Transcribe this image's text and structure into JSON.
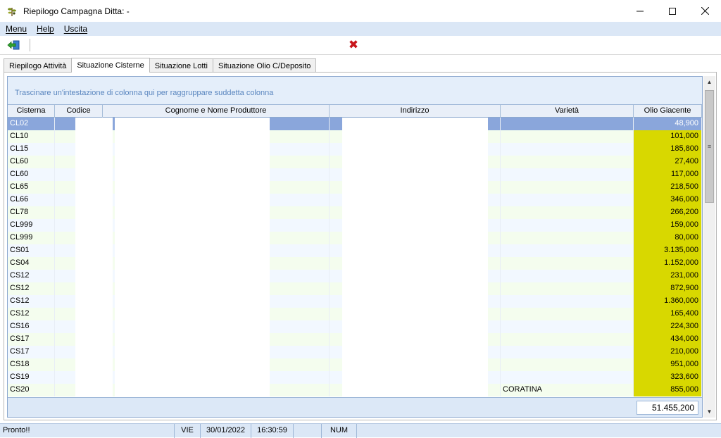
{
  "window": {
    "title": "Riepilogo Campagna Ditta: -",
    "icon": "olive-branch-icon",
    "controls": [
      "minimize",
      "maximize",
      "close"
    ]
  },
  "menu": {
    "items": [
      {
        "label": "Menu"
      },
      {
        "label": "Help"
      },
      {
        "label": "Uscita"
      }
    ]
  },
  "toolbar": {
    "exit_icon": "exit-arrow-icon",
    "close_icon": "red-x-icon",
    "close_glyph": "✖"
  },
  "tabs": [
    {
      "label": "Riepilogo Attività",
      "active": false
    },
    {
      "label": "Situazione Cisterne",
      "active": true
    },
    {
      "label": "Situazione Lotti",
      "active": false
    },
    {
      "label": "Situazione Olio C/Deposito",
      "active": false
    }
  ],
  "grid": {
    "group_hint": "Trascinare un'intestazione di colonna qui per raggruppare suddetta colonna",
    "columns": [
      "Cisterna",
      "Codice",
      "Cognome e Nome Produttore",
      "Indirizzo",
      "Varietà",
      "Olio Giacente"
    ],
    "rows": [
      {
        "cisterna": "CL02",
        "varieta": "",
        "olio": "48,900"
      },
      {
        "cisterna": "CL10",
        "varieta": "",
        "olio": "101,000"
      },
      {
        "cisterna": "CL15",
        "varieta": "",
        "olio": "185,800"
      },
      {
        "cisterna": "CL60",
        "varieta": "",
        "olio": "27,400"
      },
      {
        "cisterna": "CL60",
        "varieta": "",
        "olio": "117,000"
      },
      {
        "cisterna": "CL65",
        "varieta": "",
        "olio": "218,500"
      },
      {
        "cisterna": "CL66",
        "varieta": "",
        "olio": "346,000"
      },
      {
        "cisterna": "CL78",
        "varieta": "",
        "olio": "266,200"
      },
      {
        "cisterna": "CL999",
        "varieta": "",
        "olio": "159,000"
      },
      {
        "cisterna": "CL999",
        "varieta": "",
        "olio": "80,000"
      },
      {
        "cisterna": "CS01",
        "varieta": "",
        "olio": "3.135,000"
      },
      {
        "cisterna": "CS04",
        "varieta": "",
        "olio": "1.152,000"
      },
      {
        "cisterna": "CS12",
        "varieta": "",
        "olio": "231,000"
      },
      {
        "cisterna": "CS12",
        "varieta": "",
        "olio": "872,900"
      },
      {
        "cisterna": "CS12",
        "varieta": "",
        "olio": "1.360,000"
      },
      {
        "cisterna": "CS12",
        "varieta": "",
        "olio": "165,400"
      },
      {
        "cisterna": "CS16",
        "varieta": "",
        "olio": "224,300"
      },
      {
        "cisterna": "CS17",
        "varieta": "",
        "olio": "434,000"
      },
      {
        "cisterna": "CS17",
        "varieta": "",
        "olio": "210,000"
      },
      {
        "cisterna": "CS18",
        "varieta": "",
        "olio": "951,000"
      },
      {
        "cisterna": "CS19",
        "varieta": "",
        "olio": "323,600"
      },
      {
        "cisterna": "CS20",
        "varieta": "CORATINA",
        "olio": "855,000"
      }
    ],
    "selected_index": 0,
    "total": "51.455,200"
  },
  "colors": {
    "selected_row": "#8aa6db",
    "oil_column": "#d8d800",
    "group_text": "#5a86bf"
  },
  "statusbar": {
    "status": "Pronto!!",
    "day": "VIE",
    "date": "30/01/2022",
    "time": "16:30:59",
    "num": "NUM"
  }
}
